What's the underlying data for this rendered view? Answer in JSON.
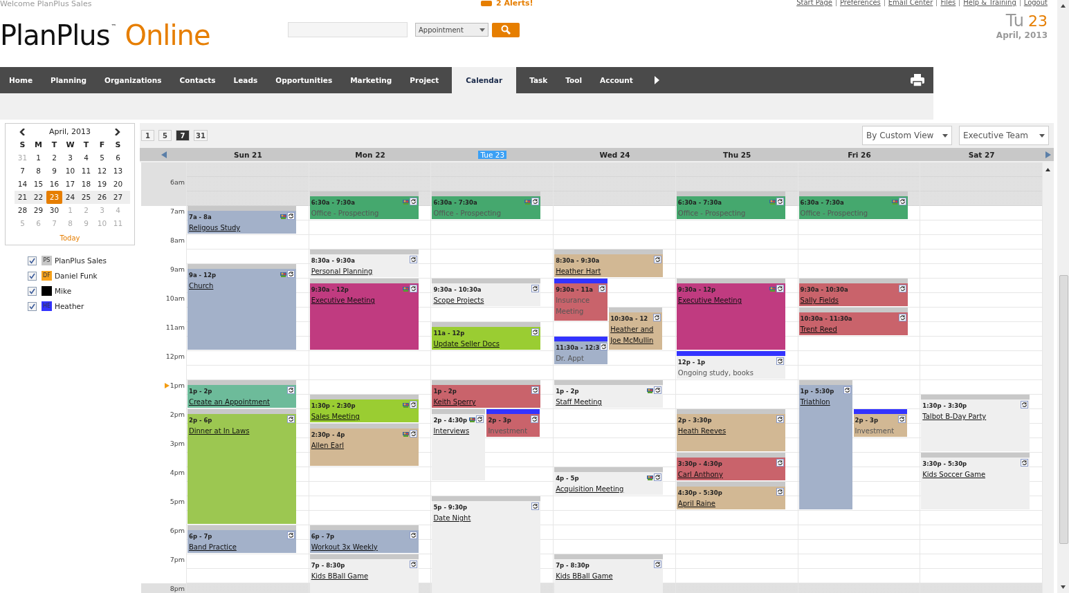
{
  "header": {
    "welcome": "Welcome PlanPlus Sales",
    "alerts": "2 Alerts!",
    "links": [
      "Start Page",
      "Preferences",
      "Email Center",
      "Files",
      "Help & Training",
      "Logout"
    ],
    "logo": {
      "name": "PlanPlus",
      "mark": "™",
      "product": "Online"
    },
    "search": {
      "type_select": "Appointment"
    },
    "date": {
      "weekday": "Tu",
      "day": "23",
      "month": "April, 2013"
    }
  },
  "nav": [
    {
      "label": "Home",
      "selected": false
    },
    {
      "label": "Planning",
      "selected": false
    },
    {
      "label": "Organizations",
      "selected": false
    },
    {
      "label": "Contacts",
      "selected": false
    },
    {
      "label": "Leads",
      "selected": false
    },
    {
      "label": "Opportunities",
      "selected": false
    },
    {
      "label": "Marketing",
      "selected": false
    },
    {
      "label": "Project",
      "selected": false
    },
    {
      "label": "Calendar",
      "selected": true
    },
    {
      "label": "Task",
      "selected": false
    },
    {
      "label": "Tool",
      "selected": false
    },
    {
      "label": "Account",
      "selected": false
    }
  ],
  "mini_calendar": {
    "title": "April, 2013",
    "weekdays": [
      "S",
      "M",
      "T",
      "W",
      "T",
      "F",
      "S"
    ],
    "weeks": [
      {
        "selected": false,
        "days": [
          {
            "d": "31",
            "other": true,
            "selected": false
          },
          {
            "d": "1",
            "other": false,
            "selected": false
          },
          {
            "d": "2",
            "other": false,
            "selected": false
          },
          {
            "d": "3",
            "other": false,
            "selected": false
          },
          {
            "d": "4",
            "other": false,
            "selected": false
          },
          {
            "d": "5",
            "other": false,
            "selected": false
          },
          {
            "d": "6",
            "other": false,
            "selected": false
          }
        ]
      },
      {
        "selected": false,
        "days": [
          {
            "d": "7",
            "other": false,
            "selected": false
          },
          {
            "d": "8",
            "other": false,
            "selected": false
          },
          {
            "d": "9",
            "other": false,
            "selected": false
          },
          {
            "d": "10",
            "other": false,
            "selected": false
          },
          {
            "d": "11",
            "other": false,
            "selected": false
          },
          {
            "d": "12",
            "other": false,
            "selected": false
          },
          {
            "d": "13",
            "other": false,
            "selected": false
          }
        ]
      },
      {
        "selected": false,
        "days": [
          {
            "d": "14",
            "other": false,
            "selected": false
          },
          {
            "d": "15",
            "other": false,
            "selected": false
          },
          {
            "d": "16",
            "other": false,
            "selected": false
          },
          {
            "d": "17",
            "other": false,
            "selected": false
          },
          {
            "d": "18",
            "other": false,
            "selected": false
          },
          {
            "d": "19",
            "other": false,
            "selected": false
          },
          {
            "d": "20",
            "other": false,
            "selected": false
          }
        ]
      },
      {
        "selected": true,
        "days": [
          {
            "d": "21",
            "other": false,
            "selected": false
          },
          {
            "d": "22",
            "other": false,
            "selected": false
          },
          {
            "d": "23",
            "other": false,
            "selected": true
          },
          {
            "d": "24",
            "other": false,
            "selected": false
          },
          {
            "d": "25",
            "other": false,
            "selected": false
          },
          {
            "d": "26",
            "other": false,
            "selected": false
          },
          {
            "d": "27",
            "other": false,
            "selected": false
          }
        ]
      },
      {
        "selected": false,
        "days": [
          {
            "d": "28",
            "other": false,
            "selected": false
          },
          {
            "d": "29",
            "other": false,
            "selected": false
          },
          {
            "d": "30",
            "other": false,
            "selected": false
          },
          {
            "d": "1",
            "other": true,
            "selected": false
          },
          {
            "d": "2",
            "other": true,
            "selected": false
          },
          {
            "d": "3",
            "other": true,
            "selected": false
          },
          {
            "d": "4",
            "other": true,
            "selected": false
          }
        ]
      },
      {
        "selected": false,
        "days": [
          {
            "d": "5",
            "other": true,
            "selected": false
          },
          {
            "d": "6",
            "other": true,
            "selected": false
          },
          {
            "d": "7",
            "other": true,
            "selected": false
          },
          {
            "d": "8",
            "other": true,
            "selected": false
          },
          {
            "d": "9",
            "other": true,
            "selected": false
          },
          {
            "d": "10",
            "other": true,
            "selected": false
          },
          {
            "d": "11",
            "other": true,
            "selected": false
          }
        ]
      }
    ],
    "today": "Today"
  },
  "calendars": [
    {
      "initials": "PS",
      "name": "PlanPlus Sales",
      "checked": true,
      "color": "#c8c8c8"
    },
    {
      "initials": "DF",
      "name": "Daniel Funk",
      "checked": true,
      "color": "#f7a21b"
    },
    {
      "name": "Mike",
      "checked": true,
      "color": "#000000"
    },
    {
      "initials": "HE",
      "name": "Heather",
      "checked": true,
      "color": "#3333ff"
    }
  ],
  "views": [
    {
      "label": "1",
      "selected": false
    },
    {
      "label": "5",
      "selected": false
    },
    {
      "label": "7",
      "selected": true
    },
    {
      "label": "31",
      "selected": false
    }
  ],
  "filters": [
    "By Custom View",
    "Executive Team"
  ],
  "hours": [
    {
      "label": "6am",
      "current": false
    },
    {
      "label": "7am",
      "current": false
    },
    {
      "label": "8am",
      "current": false
    },
    {
      "label": "9am",
      "current": false
    },
    {
      "label": "10am",
      "current": false
    },
    {
      "label": "11am",
      "current": false
    },
    {
      "label": "12pm",
      "current": false
    },
    {
      "label": "1pm",
      "current": true
    },
    {
      "label": "2pm",
      "current": false
    },
    {
      "label": "3pm",
      "current": false
    },
    {
      "label": "4pm",
      "current": false
    },
    {
      "label": "5pm",
      "current": false
    },
    {
      "label": "6pm",
      "current": false
    },
    {
      "label": "7pm",
      "current": false
    },
    {
      "label": "8pm",
      "current": false
    }
  ],
  "days": [
    {
      "label": "Sun 21",
      "selected": false,
      "events": [
        {
          "time": "7a - 8a",
          "title": "Religous Study",
          "color": "#a3b1c9",
          "linked": true,
          "shared": true,
          "flagged": false
        },
        {
          "time": "9a - 12p",
          "title": "Church",
          "color": "#a3b1c9",
          "linked": true,
          "shared": true,
          "flagged": false
        },
        {
          "time": "1p - 2p",
          "title": "Create an Appointment",
          "color": "#6dbb9a",
          "linked": true,
          "shared": false,
          "flagged": false
        },
        {
          "time": "2p - 6p",
          "title": "Dinner at In Laws",
          "color": "#9cc751",
          "linked": true,
          "shared": false,
          "flagged": false
        },
        {
          "time": "6p - 7p",
          "title": "Band Practice",
          "color": "#a3b1c9",
          "linked": true,
          "shared": false,
          "flagged": false
        }
      ]
    },
    {
      "label": "Mon 22",
      "selected": false,
      "events": [
        {
          "time": "6:30a - 7:30a",
          "title": "Office - Prospecting",
          "color": "#45a86e",
          "linked": false,
          "shared": true,
          "flagged": false
        },
        {
          "time": "8:30a - 9:30a",
          "title": "Personal Planning",
          "color": "#efefef",
          "linked": true,
          "shared": false,
          "flagged": false
        },
        {
          "time": "9:30a - 12p",
          "title": "Executive Meeting",
          "color": "#c03b80",
          "linked": true,
          "shared": true,
          "flagged": false
        },
        {
          "time": "1:30p - 2:30p",
          "title": "Sales Meeting",
          "color": "#9acd32",
          "linked": true,
          "shared": true,
          "flagged": false
        },
        {
          "time": "2:30p - 4p",
          "title": "Allen Earl",
          "color": "#d2b894",
          "linked": true,
          "shared": true,
          "flagged": false
        },
        {
          "time": "6p - 7p",
          "title": "Workout 3x Weekly",
          "color": "#a3b1c9",
          "linked": true,
          "shared": false,
          "flagged": false
        },
        {
          "time": "7p - 8:30p",
          "title": "Kids BBall Game",
          "color": "#efefef",
          "linked": true,
          "shared": false,
          "flagged": false
        }
      ]
    },
    {
      "label": "Tue 23",
      "selected": true,
      "events": [
        {
          "time": "6:30a - 7:30a",
          "title": "Office - Prospecting",
          "color": "#45a86e",
          "linked": false,
          "shared": true,
          "flagged": false
        },
        {
          "time": "9:30a - 10:30a",
          "title": "Scope Projects",
          "color": "#efefef",
          "linked": true,
          "shared": false,
          "flagged": false
        },
        {
          "time": "11a - 12p",
          "title": "Update Seller Docs",
          "color": "#9acd32",
          "linked": true,
          "shared": false,
          "flagged": false
        },
        {
          "time": "1p - 2p",
          "title": "Keith Sperry",
          "color": "#c9636b",
          "linked": true,
          "shared": false,
          "flagged": false
        },
        {
          "time": "2p - 4:30p",
          "title": "Interviews",
          "color": "#efefef",
          "linked": true,
          "shared": true,
          "flagged": false
        },
        {
          "time": "2p - 3p",
          "title": "Investment",
          "color": "#c9636b",
          "linked": false,
          "shared": false,
          "flagged": true
        },
        {
          "time": "5p - 9:30p",
          "title": "Date Night",
          "color": "#efefef",
          "linked": true,
          "shared": false,
          "flagged": false
        }
      ]
    },
    {
      "label": "Wed 24",
      "selected": false,
      "events": [
        {
          "time": "8:30a - 9:30a",
          "title": "Heather Hart",
          "color": "#d2b894",
          "linked": true,
          "shared": false,
          "flagged": false
        },
        {
          "time": "9:30a - 11a",
          "title": "Insurance Meeting",
          "color": "#c9636b",
          "linked": false,
          "shared": false,
          "flagged": true
        },
        {
          "time": "10:30a - 12",
          "title": "Heather and Joe McMullin",
          "color": "#d2b894",
          "linked": true,
          "shared": false,
          "flagged": false
        },
        {
          "time": "11:30a - 12:3",
          "title": "Dr. Appt",
          "color": "#a3b1c9",
          "linked": false,
          "shared": false,
          "flagged": true
        },
        {
          "time": "1p - 2p",
          "title": "Staff Meeting",
          "color": "#efefef",
          "linked": true,
          "shared": true,
          "flagged": false
        },
        {
          "time": "4p - 5p",
          "title": "Acquisition Meeting",
          "color": "#efefef",
          "linked": true,
          "shared": true,
          "flagged": false
        },
        {
          "time": "7p - 8:30p",
          "title": "Kids BBall Game",
          "color": "#efefef",
          "linked": true,
          "shared": false,
          "flagged": false
        }
      ]
    },
    {
      "label": "Thu 25",
      "selected": false,
      "events": [
        {
          "time": "6:30a - 7:30a",
          "title": "Office - Prospecting",
          "color": "#45a86e",
          "linked": false,
          "shared": true,
          "flagged": false
        },
        {
          "time": "9:30a - 12p",
          "title": "Executive Meeting",
          "color": "#c03b80",
          "linked": true,
          "shared": true,
          "flagged": false
        },
        {
          "time": "12p - 1p",
          "title": "Ongoing study, books",
          "color": "#efefef",
          "linked": false,
          "shared": false,
          "flagged": true
        },
        {
          "time": "2p - 3:30p",
          "title": "Heath Reeves",
          "color": "#d2b894",
          "linked": true,
          "shared": false,
          "flagged": false
        },
        {
          "time": "3:30p - 4:30p",
          "title": "Carl Anthony",
          "color": "#c9636b",
          "linked": true,
          "shared": false,
          "flagged": false
        },
        {
          "time": "4:30p - 5:30p",
          "title": "April Raine",
          "color": "#d2b894",
          "linked": true,
          "shared": false,
          "flagged": false
        }
      ]
    },
    {
      "label": "Fri 26",
      "selected": false,
      "events": [
        {
          "time": "6:30a - 7:30a",
          "title": "Office - Prospecting",
          "color": "#45a86e",
          "linked": false,
          "shared": true,
          "flagged": false
        },
        {
          "time": "9:30a - 10:30a",
          "title": "Sally Fields",
          "color": "#c9636b",
          "linked": true,
          "shared": false,
          "flagged": false
        },
        {
          "time": "10:30a - 11:30a",
          "title": "Trent Reed",
          "color": "#c9636b",
          "linked": true,
          "shared": false,
          "flagged": false
        },
        {
          "time": "1p - 5:30p",
          "title": "Triathlon",
          "color": "#a3b1c9",
          "linked": true,
          "shared": false,
          "flagged": false
        },
        {
          "time": "2p - 3p",
          "title": "Investment",
          "color": "#d2b894",
          "linked": false,
          "shared": false,
          "flagged": true
        }
      ]
    },
    {
      "label": "Sat 27",
      "selected": false,
      "events": [
        {
          "time": "1:30p - 3:30p",
          "title": "Talbot B-Day Party",
          "color": "#efefef",
          "linked": true,
          "shared": false,
          "flagged": false
        },
        {
          "time": "3:30p - 5:30p",
          "title": "Kids Soccer Game",
          "color": "#efefef",
          "linked": true,
          "shared": false,
          "flagged": false
        }
      ]
    }
  ]
}
